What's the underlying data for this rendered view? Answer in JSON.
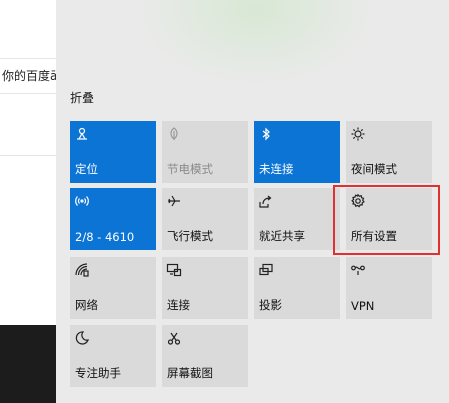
{
  "background": {
    "search_fragment": "你的百度ā"
  },
  "panel": {
    "collapse_label": "折叠",
    "accent_color": "#0c74d4",
    "tiles": [
      {
        "label": "定位",
        "icon": "location-icon",
        "active": true
      },
      {
        "label": "节电模式",
        "icon": "battery-saver-icon",
        "active": false,
        "disabled": true
      },
      {
        "label": "未连接",
        "icon": "bluetooth-icon",
        "active": true
      },
      {
        "label": "夜间模式",
        "icon": "night-light-icon",
        "active": false
      },
      {
        "label": "2/8 - 4610",
        "icon": "mobile-hotspot-icon",
        "active": true
      },
      {
        "label": "飞行模式",
        "icon": "airplane-icon",
        "active": false
      },
      {
        "label": "就近共享",
        "icon": "nearby-share-icon",
        "active": false
      },
      {
        "label": "所有设置",
        "icon": "settings-gear-icon",
        "active": false
      },
      {
        "label": "网络",
        "icon": "network-icon",
        "active": false
      },
      {
        "label": "连接",
        "icon": "connect-icon",
        "active": false
      },
      {
        "label": "投影",
        "icon": "project-icon",
        "active": false
      },
      {
        "label": "VPN",
        "icon": "vpn-icon",
        "active": false
      },
      {
        "label": "专注助手",
        "icon": "focus-assist-icon",
        "active": false
      },
      {
        "label": "屏幕截图",
        "icon": "screen-snip-icon",
        "active": false
      }
    ]
  },
  "annotation": {
    "color": "#e03030"
  }
}
